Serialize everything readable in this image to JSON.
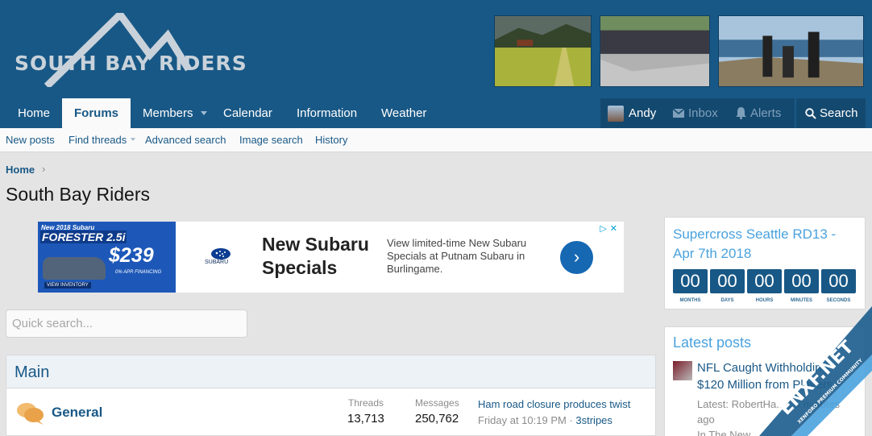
{
  "site": {
    "logo_text": "SOUTH BAY RIDERS",
    "brand_color": "#185886",
    "accent_color": "#4aa2de"
  },
  "nav": {
    "items": [
      {
        "label": "Home"
      },
      {
        "label": "Forums",
        "active": true
      },
      {
        "label": "Members",
        "has_dropdown": true
      },
      {
        "label": "Calendar"
      },
      {
        "label": "Information"
      },
      {
        "label": "Weather"
      }
    ],
    "user": "Andy",
    "inbox": "Inbox",
    "alerts": "Alerts",
    "search": "Search",
    "icons": {
      "inbox": "envelope-icon",
      "alerts": "bell-icon",
      "search": "search-icon"
    }
  },
  "subnav": {
    "items": [
      "New posts",
      "Find threads",
      "Advanced search",
      "Image search",
      "History"
    ]
  },
  "breadcrumb": {
    "home": "Home",
    "separator": "›"
  },
  "page": {
    "title": "South Bay Riders"
  },
  "ad": {
    "image_line1": "New 2018 Subaru",
    "image_line2": "FORESTER 2.5i",
    "image_price": "$239",
    "image_cta": "VIEW INVENTORY",
    "image_offer": "0% APR FINANCING",
    "logo_text": "SUBARU",
    "headline": "New Subaru Specials",
    "body": "View limited-time New Subaru Specials at Putnam Subaru in Burlingame.",
    "button_icon": "›",
    "choices": "▷✕"
  },
  "quick_search": {
    "placeholder": "Quick search..."
  },
  "category": {
    "title": "Main",
    "forums": [
      {
        "name": "General",
        "threads_label": "Threads",
        "threads": "13,713",
        "messages_label": "Messages",
        "messages": "250,762",
        "last_post_title": "Ham road closure produces twist",
        "last_post_time": "Friday at 10:19 PM · ",
        "last_post_user": "3stripes"
      }
    ]
  },
  "countdown": {
    "title": "Supercross Seattle RD13 - Apr 7th 2018",
    "units": [
      {
        "value": "00",
        "label": "MONTHS"
      },
      {
        "value": "00",
        "label": "DAYS"
      },
      {
        "value": "00",
        "label": "HOURS"
      },
      {
        "value": "00",
        "label": "MINUTES"
      },
      {
        "value": "00",
        "label": "SECONDS"
      }
    ]
  },
  "latest_posts": {
    "title": "Latest posts",
    "items": [
      {
        "title": "NFL Caught Withholding $120 Million from Players",
        "meta_line1": "Latest: RobertHa... · 5 minutes",
        "meta_line2": "ago",
        "meta_line3": "In The New..."
      }
    ]
  },
  "watermark": {
    "text": "ENXF.NET",
    "subtext": "XENFORO PREMIUM COMMUNITY"
  }
}
